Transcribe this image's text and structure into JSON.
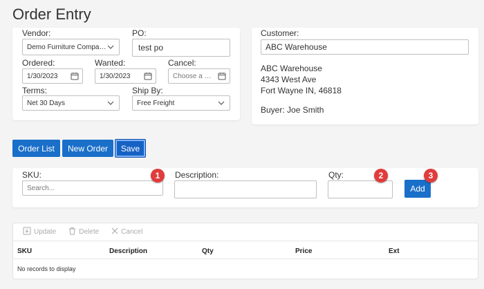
{
  "page": {
    "title": "Order Entry"
  },
  "order_form": {
    "vendor": {
      "label": "Vendor:",
      "value": "Demo Furniture Company"
    },
    "po": {
      "label": "PO:",
      "value": "test po"
    },
    "ordered": {
      "label": "Ordered:",
      "value": "1/30/2023"
    },
    "wanted": {
      "label": "Wanted:",
      "value": "1/30/2023"
    },
    "cancel": {
      "label": "Cancel:",
      "placeholder": "Choose a Da..."
    },
    "terms": {
      "label": "Terms:",
      "value": "Net 30 Days"
    },
    "ship_by": {
      "label": "Ship By:",
      "value": "Free Freight"
    }
  },
  "customer": {
    "label": "Customer:",
    "value": "ABC Warehouse",
    "address": [
      "ABC Warehouse",
      "4343 West Ave",
      "Fort Wayne IN, 46818"
    ],
    "buyer": "Buyer: Joe Smith"
  },
  "actions": {
    "order_list": "Order List",
    "new_order": "New Order",
    "save": "Save"
  },
  "entry": {
    "sku": {
      "label": "SKU:",
      "placeholder": "Search..."
    },
    "description": {
      "label": "Description:",
      "value": ""
    },
    "qty": {
      "label": "Qty:",
      "value": ""
    },
    "add": "Add",
    "badges": [
      "1",
      "2",
      "3"
    ]
  },
  "grid": {
    "toolbar": {
      "update": "Update",
      "delete": "Delete",
      "cancel": "Cancel"
    },
    "columns": [
      "SKU",
      "Description",
      "Qty",
      "Price",
      "Ext"
    ],
    "empty_message": "No records to display"
  },
  "colors": {
    "accent": "#1a6fc9",
    "badge": "#e03c3c",
    "background": "#f4f4f4"
  },
  "icons": [
    "calendar-icon",
    "chevron-down-icon",
    "update-icon",
    "delete-icon",
    "cancel-icon"
  ]
}
